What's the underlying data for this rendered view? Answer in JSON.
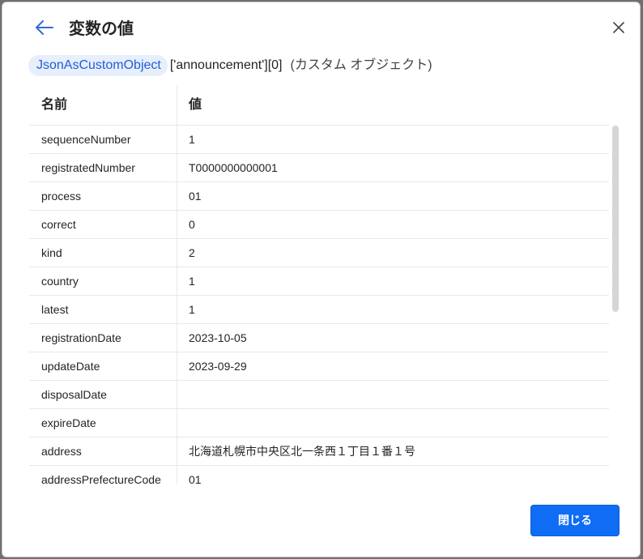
{
  "dialog": {
    "title": "変数の値",
    "close_button_label": "閉じる"
  },
  "variable": {
    "name": "JsonAsCustomObject",
    "path": "['announcement'][0]",
    "type": "(カスタム オブジェクト)"
  },
  "table": {
    "headers": {
      "name": "名前",
      "value": "値"
    },
    "rows": [
      {
        "name": "sequenceNumber",
        "value": "1"
      },
      {
        "name": "registratedNumber",
        "value": "T0000000000001"
      },
      {
        "name": "process",
        "value": "01"
      },
      {
        "name": "correct",
        "value": "0"
      },
      {
        "name": "kind",
        "value": "2"
      },
      {
        "name": "country",
        "value": "1"
      },
      {
        "name": "latest",
        "value": "1"
      },
      {
        "name": "registrationDate",
        "value": "2023-10-05"
      },
      {
        "name": "updateDate",
        "value": "2023-09-29"
      },
      {
        "name": "disposalDate",
        "value": ""
      },
      {
        "name": "expireDate",
        "value": ""
      },
      {
        "name": "address",
        "value": "北海道札幌市中央区北一条西１丁目１番１号"
      },
      {
        "name": "addressPrefectureCode",
        "value": "01"
      }
    ]
  },
  "icons": {
    "back": "arrow-left-icon",
    "close": "close-icon"
  },
  "colors": {
    "accent": "#0f6cf5",
    "chip_background": "#e7eefc",
    "chip_text": "#1f5fd6"
  }
}
